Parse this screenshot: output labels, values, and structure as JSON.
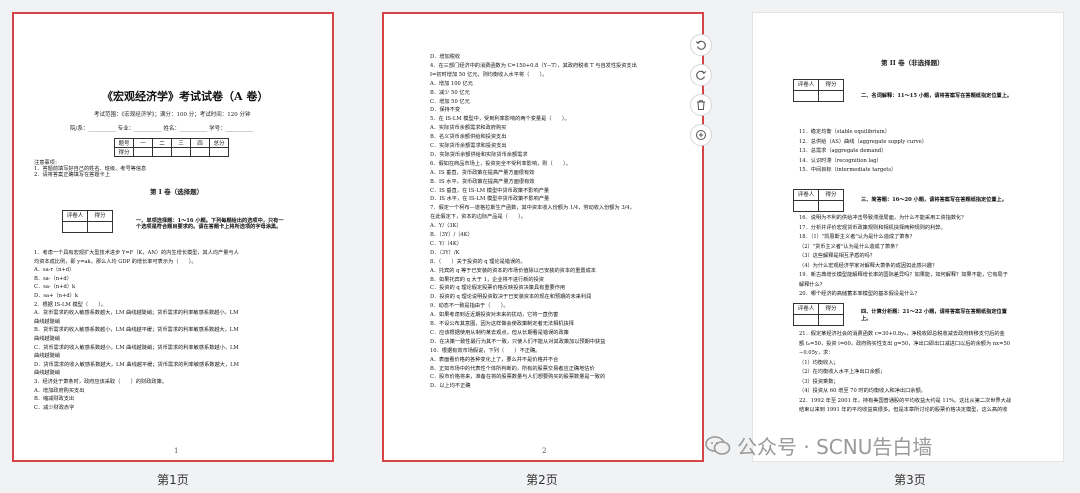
{
  "pages": [
    {
      "caption": "第1页",
      "number": "1",
      "title": "《宏观经济学》考试试卷（A 卷）",
      "meta_line": "考试范围：《宏观经济学》；满分：100 分；考试时间：120 分钟",
      "info_line": "院/系：__________ 专业：__________ 姓名：__________ 学号：__________",
      "score_table": {
        "row1": [
          "题号",
          "一",
          "二",
          "三",
          "四",
          "总分"
        ],
        "row2": [
          "得分",
          "",
          "",
          "",
          "",
          ""
        ]
      },
      "notes": [
        "注意事项：",
        "1．答题前填写好自己的姓名、班级、考号等信息",
        "2．请将答案正确填写在答题卡上"
      ],
      "section_title": "第 I 卷（选择题）",
      "grader": [
        "评卷人",
        "得分"
      ],
      "section_instructions": [
        "一、单项选择题：1～16 小题。下列每题给出的选项中，只有一",
        "个选项是符合题目要求的。请在答题卡上将所选项的字母涂黑。"
      ],
      "lines": [
        "1．考虑一个具有宏观扩大型技术进步 Y=F（K，AN）的内生增长模型，其人均产量与人",
        "均资本成比例，即 y=ak，那么人均 GDP 的增长率可表示为（　　）。",
        "A．sa-r（n+d）",
        "B．sa-（n+d）",
        "C．sa-（n+d）k",
        "D．sa+（n+d）k",
        "2．根据 IS-LM 模型（　　）。",
        "A．货币需求的收入敏感系数越大，LM 曲线越陡峭；货币需求的利率敏感系数越小，LM",
        "曲线越陡峭",
        "B．货币需求的收入敏感系数越小，LM 曲线越平缓；货币需求的利率敏感系数越大，LM",
        "曲线越陡峭",
        "C．货币需求的收入敏感系数越小，LM 曲线越陡峭；货币需求的利率敏感系数越小，LM",
        "曲线越陡峭",
        "D．货币需求的收入敏感系数越大，LM 曲线越平缓；货币需求的利率敏感系数越大，LM",
        "曲线越陡峭",
        "3．经济处于萧条时，政府应该采取（　　）的财政政策。",
        "A．增加政府购买支出",
        "B．缩减财政支出",
        "C．减少财政赤字"
      ]
    },
    {
      "caption": "第2页",
      "number": "2",
      "lines": [
        "D．增加税收",
        "4．在三部门经济中的消费函数为 C=150+0.8（Y−T），其政府税收 T 与自发性投资支出",
        "I=初时增加 50 亿元，则均衡收入水平将（　　）。",
        "A．增加 100 亿元",
        "B．减少 50 亿元",
        "C．增加 50 亿元",
        "D．保持不变",
        "5．在 IS-LM 模型中，受到利率影响的两个变量是（　　）。",
        "A．实际货币余额需求和政府购买",
        "B．名义货币余额供给和投资支出",
        "C．实际货币余额需求和投资支出",
        "D．实际货币余额供给和实际货币余额需求",
        "6．假如在商品市场上，投资完全不受利率影响，则（　　）。",
        "A．IS 垂直，货币政策在提高产量方面很有效",
        "B．IS 水平，货币政策在提高产量方面很有效",
        "C．IS 垂直，在 IS-LM 模型中货币政策不影响产量",
        "D．IS 水平，在 IS-LM 模型中货币政策不影响产量",
        "7．假定一个柯布—道格拉斯生产函数，其中资本收入份额为 1/4，劳动收入份额为 3/4，",
        "在此假定下，资本的边际产品是（　　）。",
        "A．Y/（3K）",
        "B．（3Y）/（4K）",
        "C．Y/（4K）",
        "D．（3Y）/K",
        "8．（　　）关于投资的 q 理论是错误的。",
        "A．托宾的 q 等于已安装的资本的市场价值除以已安装的资本的重置成本",
        "B．如果托宾的 q 大于 1，企业将不进行新的投资",
        "C．投资的 q 理论假定股票价格反映投资决策具有重要作用",
        "D．投资的 q 理论说明投资取决于已安装资本的现在和预期的未来利润",
        "9．动态不一致是指由于（　　）。",
        "A．如果考虑到近近期投资对未来的扰动，它将一直伤害",
        "B．不设公布其意图，因为这样做会使政策制定者无法相机抉择",
        "C．应该根据使用从制约某去观点，但从长期看是错误的政策",
        "D．在决策一致性最行为其不一致，只使人们不能从对其政策加以预期中获益",
        "10．根据有效市场假说，下列（　　）不正确。",
        "A．表面看价格的各种变化上了，要么并不是价格并不合",
        "B．正如市场中的代表性个体所判断的，所有的股票交易者应正确地估价",
        "C．股市价格将来，准备在将的股票数量与人们想要购买的股票数量是一致的",
        "D．以上均不正确"
      ]
    },
    {
      "caption": "第3页",
      "number": "",
      "title": "第 II 卷（非选择题）",
      "sections": [
        {
          "grader": [
            "评卷人",
            "得分"
          ],
          "heading": "二、名词解释：11～15 小题，请将答案写在答题纸指定位置上。",
          "items": [
            "11．稳定均衡（stable equilibrium）",
            "12．总供给（AS）曲线（aggregate supply curve）",
            "13．总需求（aggregate demand）",
            "14．认识时滞（recognition lag）",
            "15．中间目标（intermediate targets）"
          ]
        },
        {
          "grader": [
            "评卷人",
            "得分"
          ],
          "heading": "三、简答题：16～20 小题，请将答案写在答题纸指定位置上。",
          "items": [
            "16．说明为不利的供给冲击导致滞涨局面，为什么不能采用工资指数化？",
            "17．分析并评价宏观货币政策规则和相机抉择两种规则的利弊。",
            "18．（1）\"凯恩斯主义者\"认为是什么造成了萧条？",
            "（2）\"货币主义者\"认为是什么造成了萧条？",
            "（3）这些解释是相互矛盾的吗？",
            "（4）为什么宏观经济学家对解释大萧条的成因如此感兴趣？",
            "19．新古典增长模型能解释增长率的国际差异吗？如果能，如何解释？如果不能，它有局于",
            "解释什么？",
            "20．哪个经济的高储蓄本率模型的基本假设是什么？"
          ]
        },
        {
          "grader": [
            "评卷人",
            "得分"
          ],
          "heading": "四、计算分析题：21～22 小题，请将答案写在答题纸指定位置",
          "heading2": "上。",
          "items": [
            "21．假定某经济社会的消费函数 c=30+0.8y₀，净税收即总税收减去政府转移支付后的金",
            "额 t₀=50，投资 i=60，政府购买性支出 g=50，净出口即出口减进口以后的余额为 nx=50",
            "−0.05y，求：",
            "（1）均衡收入；",
            "（2）在均衡收入水平上净出口余额；",
            "（3）投资乘数；",
            "（4）投资从 60 增至 70 时的均衡收入和净出口余额。",
            "22．1992 年至 2001 年，持有美国普通股的平均收益大约是 11%。这比从第二次世界大战",
            "结束以来到 1991 年的平均收益高很多。但是本章所讨论的股票价格决定模型，这么高的收"
          ]
        }
      ]
    }
  ],
  "toolbar": {
    "buttons": [
      "rotate-ccw-icon",
      "rotate-cw-icon",
      "trash-icon",
      "zoom-in-icon"
    ]
  },
  "watermark": {
    "text": "公众号 · SCNU告白墙"
  },
  "colors": {
    "selected_border": "#d64545",
    "background": "#f1f2f4"
  }
}
